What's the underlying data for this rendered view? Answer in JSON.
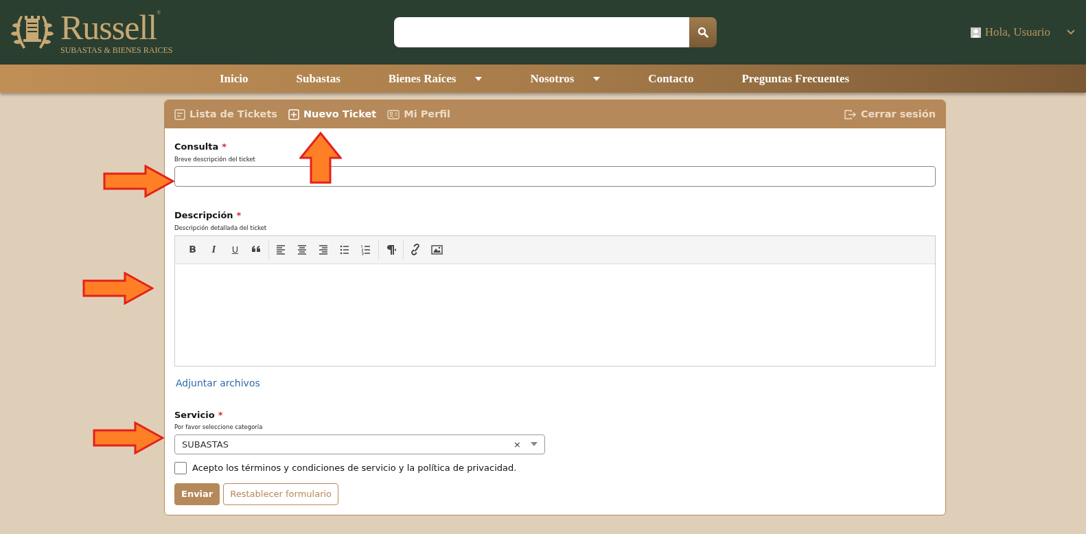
{
  "logo": {
    "name": "Russell",
    "mark": "®",
    "tagline": "SUBASTAS & BIENES RAICES"
  },
  "user": {
    "greeting": "Hola, Usuario"
  },
  "nav": [
    {
      "label": "Inicio",
      "dropdown": false
    },
    {
      "label": "Subastas",
      "dropdown": false
    },
    {
      "label": "Bienes Raíces",
      "dropdown": true
    },
    {
      "label": "Nosotros",
      "dropdown": true
    },
    {
      "label": "Contacto",
      "dropdown": false
    },
    {
      "label": "Preguntas Frecuentes",
      "dropdown": false
    }
  ],
  "tabs": [
    {
      "label": "Lista de Tickets",
      "kind": "list",
      "selected": false
    },
    {
      "label": "Nuevo Ticket",
      "kind": "new",
      "selected": true
    },
    {
      "label": "Mi Perfil",
      "kind": "profile",
      "selected": false
    }
  ],
  "logout": "Cerrar sesión",
  "consulta": {
    "label": "Consulta",
    "required_mark": "*",
    "help": "Breve descripción del ticket"
  },
  "descripcion": {
    "label": "Descripción",
    "required_mark": "*",
    "help": "Descripción detallada del ticket"
  },
  "editor_format": [
    "B",
    "I",
    "U"
  ],
  "attach_link": "Adjuntar archivos",
  "servicio": {
    "label": "Servicio",
    "required_mark": "*",
    "help": "Por favor seleccione categoría",
    "value": "SUBASTAS",
    "clear": "×"
  },
  "terms": {
    "label": "Acepto los términos y condiciones de servicio y la política de privacidad.",
    "checked": false
  },
  "buttons": [
    {
      "label": "Enviar",
      "kind": "primary"
    },
    {
      "label": "Restablecer formulario",
      "kind": "outline"
    }
  ],
  "annotations": [
    {
      "kind": "up"
    },
    {
      "kind": "right"
    },
    {
      "kind": "right"
    },
    {
      "kind": "right"
    }
  ]
}
